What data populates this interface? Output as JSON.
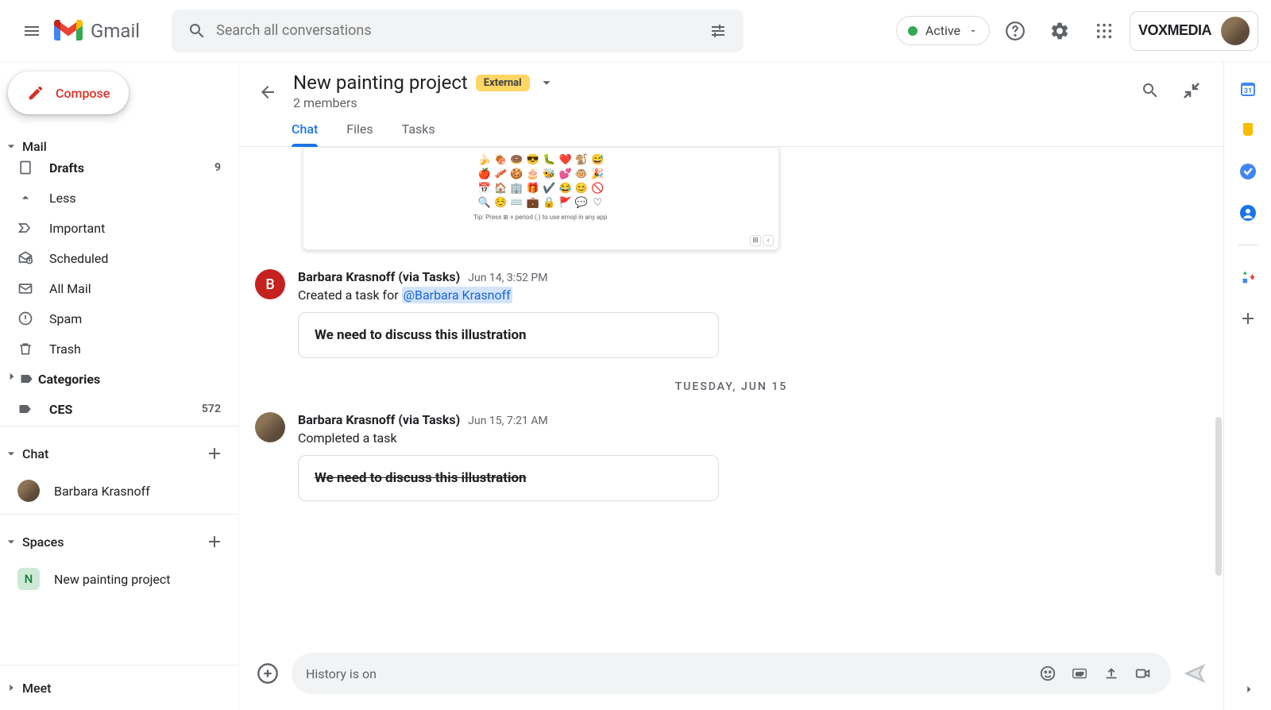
{
  "header": {
    "app_name": "Gmail",
    "search_placeholder": "Search all conversations",
    "status_label": "Active",
    "org_name": "VOXMEDIA"
  },
  "sidebar": {
    "compose_label": "Compose",
    "mail_section_label": "Mail",
    "chat_section_label": "Chat",
    "spaces_section_label": "Spaces",
    "meet_section_label": "Meet",
    "nav": {
      "drafts": {
        "label": "Drafts",
        "count": "9"
      },
      "less": {
        "label": "Less"
      },
      "important": {
        "label": "Important"
      },
      "scheduled": {
        "label": "Scheduled"
      },
      "all_mail": {
        "label": "All Mail"
      },
      "spam": {
        "label": "Spam"
      },
      "trash": {
        "label": "Trash"
      },
      "categories": {
        "label": "Categories"
      },
      "ces": {
        "label": "CES",
        "count": "572"
      }
    },
    "chat_items": {
      "0": {
        "name": "Barbara Krasnoff"
      }
    },
    "space_items": {
      "0": {
        "initial": "N",
        "name": "New painting project"
      }
    }
  },
  "space": {
    "title": "New painting project",
    "external_badge": "External",
    "members": "2 members",
    "tabs": {
      "chat": "Chat",
      "files": "Files",
      "tasks": "Tasks"
    }
  },
  "messages": {
    "emoji_tip": "Tip: Press ⊞ + period (.) to use emoji in any app",
    "msg0": {
      "author": "Barbara Krasnoff (via Tasks)",
      "time": "Jun 14, 3:52 PM",
      "text_prefix": "Created a task for ",
      "mention": "@Barbara Krasnoff",
      "task_title": "We need to discuss this illustration",
      "avatar_initial": "B"
    },
    "date_separator": "TUESDAY, JUN 15",
    "msg1": {
      "author": "Barbara Krasnoff (via Tasks)",
      "time": "Jun 15, 7:21 AM",
      "text": "Completed a task",
      "task_title": "We need to discuss this illustration"
    }
  },
  "composer": {
    "placeholder": "History is on"
  }
}
